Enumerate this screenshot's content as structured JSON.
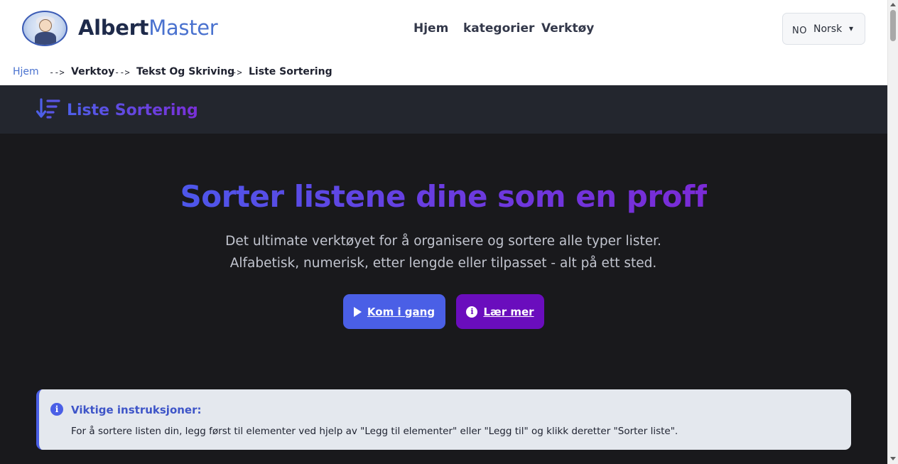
{
  "header": {
    "brand_part1": "Albert",
    "brand_part2": "Master",
    "nav": [
      "Hjem",
      "kategorier",
      "Verktøy"
    ],
    "language": {
      "code": "NO",
      "name": "Norsk",
      "caret": "▾"
    }
  },
  "breadcrumb": {
    "items": [
      "Hjem",
      "Verktoy",
      "Tekst Og Skriving",
      "Liste Sortering"
    ],
    "separator": "-->"
  },
  "tool": {
    "title": "Liste Sortering",
    "icon": "sort-descending-icon"
  },
  "hero": {
    "title": "Sorter listene dine som en proff",
    "subtitle": "Det ultimate verktøyet for å organisere og sortere alle typer lister. Alfabetisk, numerisk, etter lengde eller tilpasset - alt på ett sted.",
    "start_button": "Kom i gang",
    "learn_button": "Lær mer"
  },
  "info": {
    "title": "Viktige instruksjoner:",
    "text": "For å sortere listen din, legg først til elementer ved hjelp av \"Legg til elementer\" eller \"Legg til\" og klikk deretter \"Sorter liste\"."
  },
  "colors": {
    "accent": "#4a5fe6",
    "purple": "#6a0dbd",
    "dark_bg": "#19191c",
    "toolbar_bg": "#23262e"
  }
}
